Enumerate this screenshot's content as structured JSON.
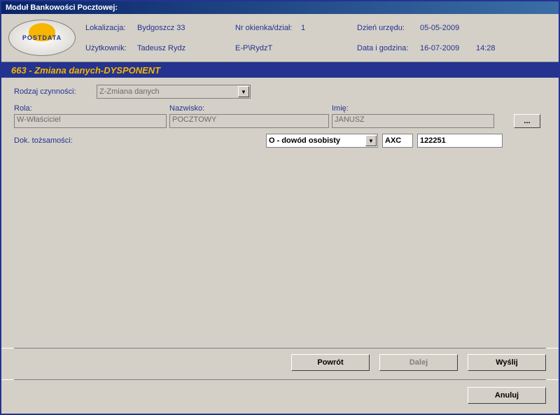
{
  "window": {
    "title": "Moduł Bankowości Pocztowej:"
  },
  "logo": {
    "text": "POSTDATA"
  },
  "header": {
    "loc_label": "Lokalizacja:",
    "loc_value": "Bydgoszcz 33",
    "window_label": "Nr okienka/dział:",
    "window_value": "1",
    "office_day_label": "Dzień urzędu:",
    "office_day_value": "05-05-2009",
    "user_label": "Użytkownik:",
    "user_value": "Tadeusz Rydz",
    "ep_label": "E-P\\RydzT",
    "datetime_label": "Data i godzina:",
    "date_value": "16-07-2009",
    "time_value": "14:28"
  },
  "section": {
    "title": "663  -  Zmiana danych-DYSPONENT"
  },
  "form": {
    "activity_label": "Rodzaj czynności:",
    "activity_value": "Z-Zmiana danych",
    "role_label": "Rola:",
    "role_value": "W-Właściciel",
    "surname_label": "Nazwisko:",
    "surname_value": "POCZTOWY",
    "name_label": "Imię:",
    "name_value": "JANUSZ",
    "doc_label": "Dok. tożsamości:",
    "doc_type": "O - dowód osobisty",
    "doc_series": "AXC",
    "doc_number": "122251",
    "ellipsis": "..."
  },
  "buttons": {
    "back": "Powrót",
    "next": "Dalej",
    "send": "Wyślij",
    "cancel": "Anuluj"
  }
}
